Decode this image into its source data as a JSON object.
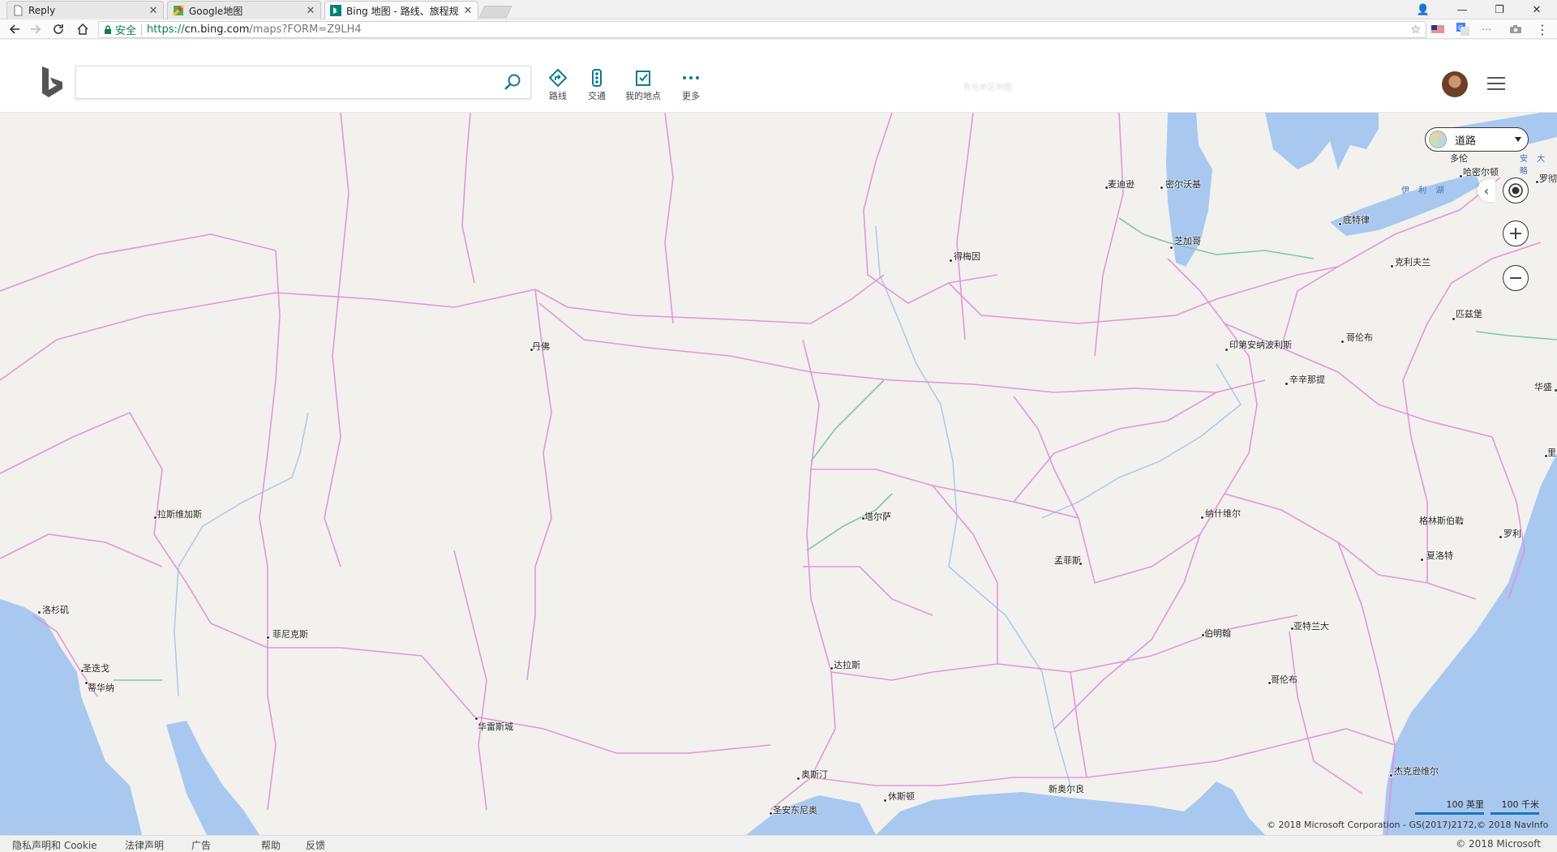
{
  "browser": {
    "tabs": [
      {
        "title": "Reply",
        "active": false
      },
      {
        "title": "Google地图",
        "active": false
      },
      {
        "title": "Bing 地图 - 路线、旅程规",
        "active": true
      }
    ],
    "url": {
      "secure_label": "安全",
      "scheme": "https://",
      "host": "cn.bing.com",
      "path": "/maps?FORM=Z9LH4"
    }
  },
  "header": {
    "search": {
      "value": "",
      "placeholder": ""
    },
    "buttons": [
      {
        "label": "路线",
        "icon": "directions-icon"
      },
      {
        "label": "交通",
        "icon": "traffic-icon"
      },
      {
        "label": "我的地点",
        "icon": "my-places-icon"
      },
      {
        "label": "更多",
        "icon": "more-icon"
      }
    ],
    "ghost_text": "有些地区地图"
  },
  "map": {
    "style_label": "道路",
    "cities": [
      {
        "name": "丹佛"
      },
      {
        "name": "拉斯维加斯"
      },
      {
        "name": "洛杉矶"
      },
      {
        "name": "圣迭戈"
      },
      {
        "name": "蒂华纳"
      },
      {
        "name": "菲尼克斯"
      },
      {
        "name": "华雷斯城"
      },
      {
        "name": "塔尔萨"
      },
      {
        "name": "达拉斯"
      },
      {
        "name": "奥斯汀"
      },
      {
        "name": "圣安东尼奥"
      },
      {
        "name": "休斯顿"
      },
      {
        "name": "新奥尔良"
      },
      {
        "name": "孟菲斯"
      },
      {
        "name": "伯明翰"
      },
      {
        "name": "亚特兰大"
      },
      {
        "name": "纳什维尔"
      },
      {
        "name": "哥伦布"
      },
      {
        "name": "杰克逊维尔"
      },
      {
        "name": "夏洛特"
      },
      {
        "name": "格林斯伯勒"
      },
      {
        "name": "罗利"
      },
      {
        "name": "印第安纳波利斯"
      },
      {
        "name": "辛辛那提"
      },
      {
        "name": "哥伦布"
      },
      {
        "name": "匹兹堡"
      },
      {
        "name": "克利夫兰"
      },
      {
        "name": "底特律"
      },
      {
        "name": "芝加哥"
      },
      {
        "name": "密尔沃基"
      },
      {
        "name": "麦迪逊"
      },
      {
        "name": "得梅因"
      },
      {
        "name": "哈密尔顿"
      },
      {
        "name": "罗彻"
      },
      {
        "name": "华盛"
      },
      {
        "name": "里"
      },
      {
        "name": "多伦"
      }
    ],
    "water_labels": [
      "伊 利 湖",
      "安 大 略"
    ],
    "scale": {
      "miles": "100 英里",
      "km": "100 千米"
    },
    "copyright": "© 2018 Microsoft Corporation - GS(2017)2172,© 2018 NavInfo"
  },
  "footer": {
    "links": [
      "隐私声明和 Cookie",
      "法律声明",
      "广告",
      "帮助",
      "反馈"
    ],
    "copyright": "© 2018 Microsoft"
  }
}
